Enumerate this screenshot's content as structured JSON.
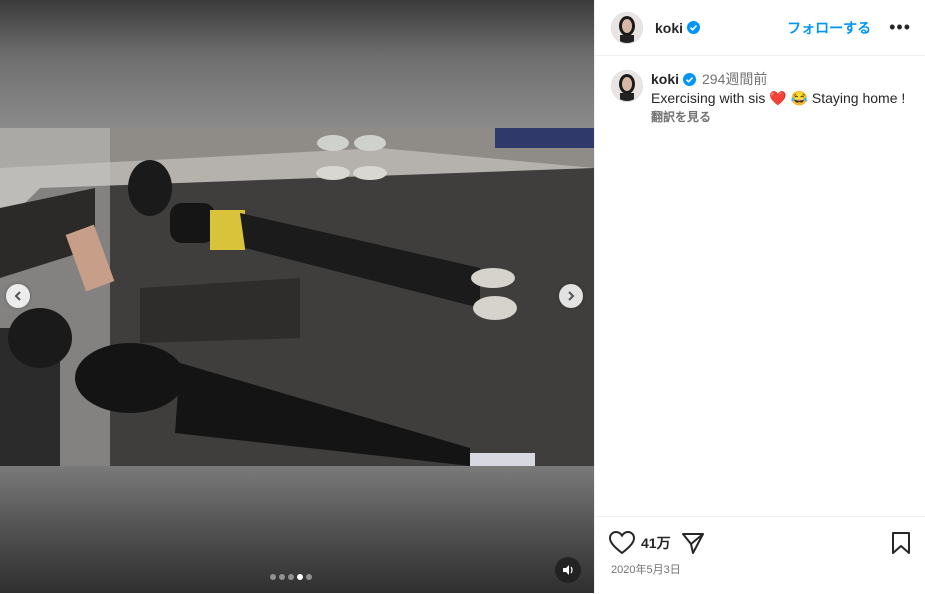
{
  "post": {
    "username": "koki",
    "follow_label": "フォローする",
    "more_label": "•••",
    "comment": {
      "username": "koki",
      "time_ago": "294週間前",
      "caption": "Exercising with sis ❤️ 😂 Staying home !",
      "translate_label": "翻訳を見る"
    },
    "likes": "41万",
    "date": "2020年5月3日",
    "carousel": {
      "count": 5,
      "active_index": 3
    }
  },
  "colors": {
    "accent": "#0095f6",
    "verified": "#0095f6"
  }
}
